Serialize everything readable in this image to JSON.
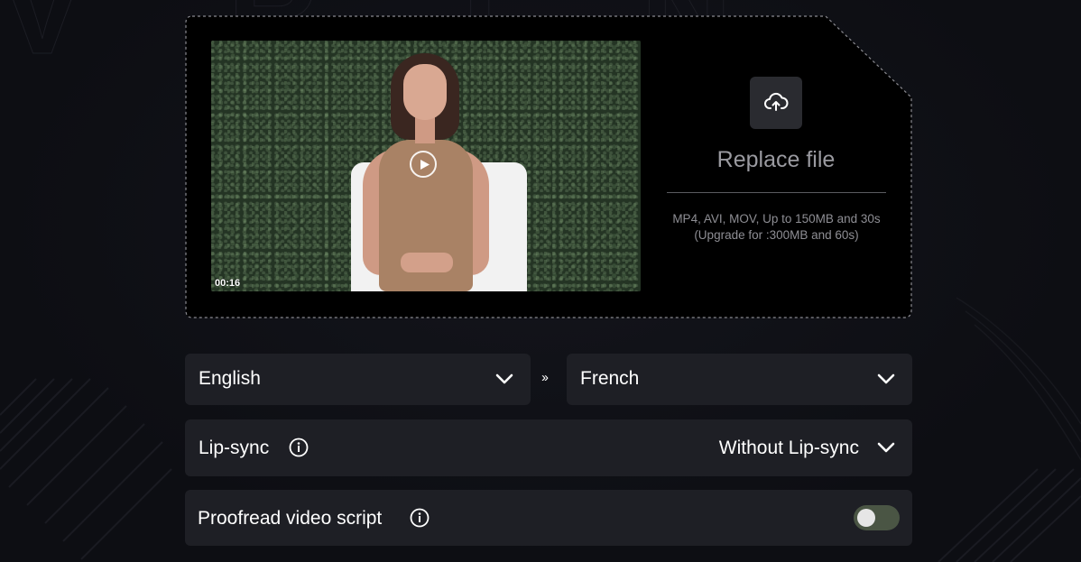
{
  "upload": {
    "replace_label": "Replace file",
    "format_info": "MP4, AVI, MOV, Up to 150MB and 30s",
    "upgrade_info": "(Upgrade for :300MB and 60s)",
    "video_duration": "00:16"
  },
  "languages": {
    "source": "English",
    "target": "French",
    "separator": "››"
  },
  "lipsync": {
    "label": "Lip-sync",
    "value": "Without Lip-sync"
  },
  "proofread": {
    "label": "Proofread video script",
    "enabled": false
  },
  "colors": {
    "background": "#0f1016",
    "panel": "#1e1f25",
    "card": "#000000",
    "toggle_track": "#4a5544",
    "muted_text": "#9a9aa0"
  },
  "icons": {
    "upload": "cloud-upload-icon",
    "play": "play-icon",
    "chevron": "chevron-down-icon",
    "info": "info-icon"
  }
}
